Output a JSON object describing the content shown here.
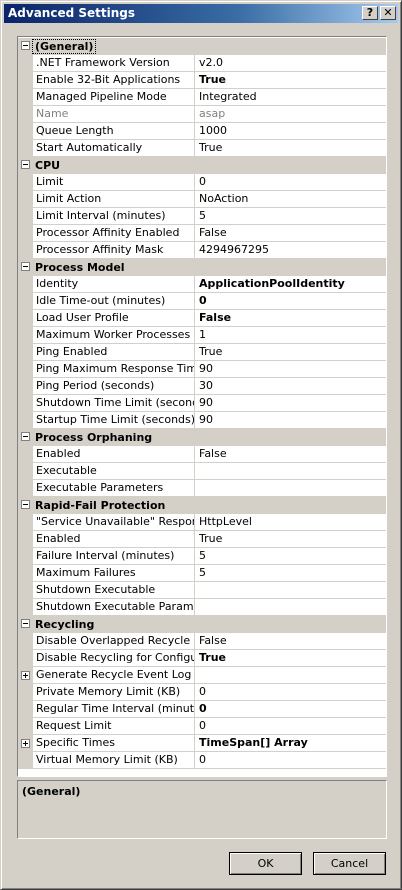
{
  "window": {
    "title": "Advanced Settings",
    "help_glyph": "?",
    "close_glyph": "✕"
  },
  "grid": {
    "categories": [
      {
        "label": "(General)",
        "properties": [
          {
            "name": ".NET Framework Version",
            "value": "v2.0"
          },
          {
            "name": "Enable 32-Bit Applications",
            "value": "True",
            "bold": true
          },
          {
            "name": "Managed Pipeline Mode",
            "value": "Integrated"
          },
          {
            "name": "Name",
            "value": "asap",
            "disabled": true
          },
          {
            "name": "Queue Length",
            "value": "1000"
          },
          {
            "name": "Start Automatically",
            "value": "True"
          }
        ]
      },
      {
        "label": "CPU",
        "properties": [
          {
            "name": "Limit",
            "value": "0"
          },
          {
            "name": "Limit Action",
            "value": "NoAction"
          },
          {
            "name": "Limit Interval (minutes)",
            "value": "5"
          },
          {
            "name": "Processor Affinity Enabled",
            "value": "False"
          },
          {
            "name": "Processor Affinity Mask",
            "value": "4294967295"
          }
        ]
      },
      {
        "label": "Process Model",
        "properties": [
          {
            "name": "Identity",
            "value": "ApplicationPoolIdentity",
            "bold": true
          },
          {
            "name": "Idle Time-out (minutes)",
            "value": "0",
            "bold": true
          },
          {
            "name": "Load User Profile",
            "value": "False",
            "bold": true
          },
          {
            "name": "Maximum Worker Processes",
            "value": "1"
          },
          {
            "name": "Ping Enabled",
            "value": "True"
          },
          {
            "name": "Ping Maximum Response Time (se",
            "value": "90"
          },
          {
            "name": "Ping Period (seconds)",
            "value": "30"
          },
          {
            "name": "Shutdown Time Limit (seconds)",
            "value": "90"
          },
          {
            "name": "Startup Time Limit (seconds)",
            "value": "90"
          }
        ]
      },
      {
        "label": "Process Orphaning",
        "properties": [
          {
            "name": "Enabled",
            "value": "False"
          },
          {
            "name": "Executable",
            "value": ""
          },
          {
            "name": "Executable Parameters",
            "value": ""
          }
        ]
      },
      {
        "label": "Rapid-Fail Protection",
        "properties": [
          {
            "name": "\"Service Unavailable\" Response T",
            "value": "HttpLevel"
          },
          {
            "name": "Enabled",
            "value": "True"
          },
          {
            "name": "Failure Interval (minutes)",
            "value": "5"
          },
          {
            "name": "Maximum Failures",
            "value": "5"
          },
          {
            "name": "Shutdown Executable",
            "value": ""
          },
          {
            "name": "Shutdown Executable Parameter",
            "value": ""
          }
        ]
      },
      {
        "label": "Recycling",
        "properties": [
          {
            "name": "Disable Overlapped Recycle",
            "value": "False"
          },
          {
            "name": "Disable Recycling for Configuratio",
            "value": "True",
            "bold": true
          },
          {
            "name": "Generate Recycle Event Log Entr",
            "value": "",
            "expandable": true
          },
          {
            "name": "Private Memory Limit (KB)",
            "value": "0"
          },
          {
            "name": "Regular Time Interval (minutes)",
            "value": "0",
            "bold": true
          },
          {
            "name": "Request Limit",
            "value": "0"
          },
          {
            "name": "Specific Times",
            "value": "TimeSpan[] Array",
            "bold": true,
            "expandable": true
          },
          {
            "name": "Virtual Memory Limit (KB)",
            "value": "0"
          }
        ]
      }
    ]
  },
  "description": {
    "title": "(General)"
  },
  "buttons": {
    "ok": "OK",
    "cancel": "Cancel"
  }
}
